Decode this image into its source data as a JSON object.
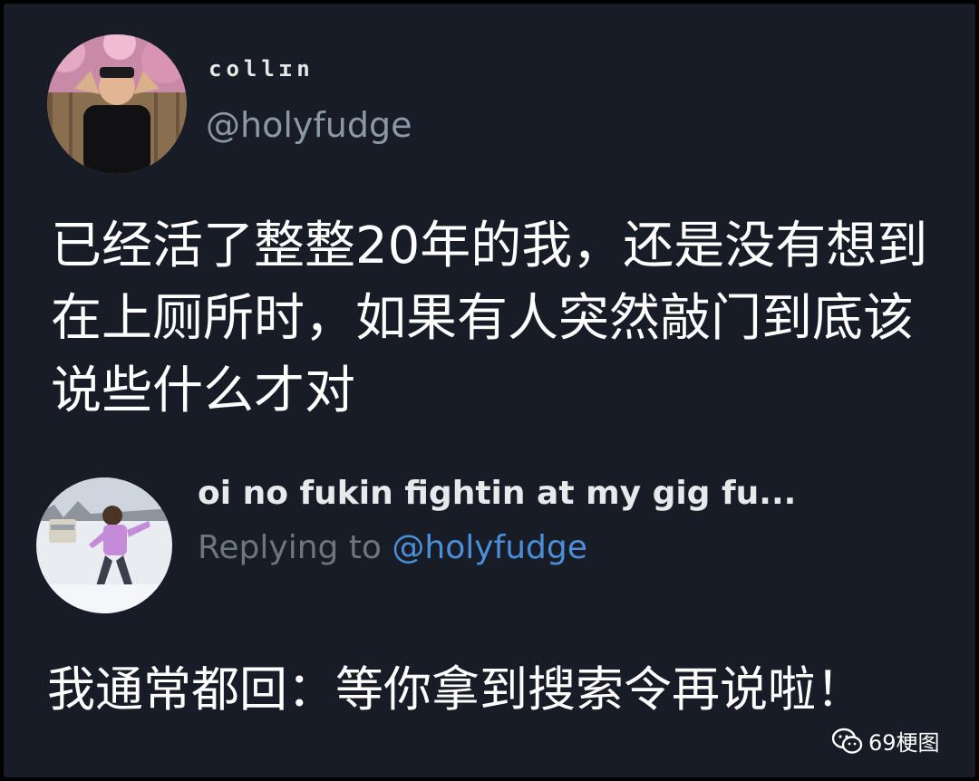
{
  "author": {
    "display_name": "collɪn",
    "handle": "@holyfudge"
  },
  "tweet": {
    "text": "已经活了整整20年的我，还是没有想到在上厕所时，如果有人突然敲门到底该说些什么才对"
  },
  "reply": {
    "author_name": "oi no fukin fightin at my gig fu...",
    "replying_prefix": "Replying to ",
    "replying_handle": "@holyfudge",
    "text": "我通常都回：等你拿到搜索令再说啦！"
  },
  "watermark": {
    "label": "69梗图",
    "icon": "wechat-icon"
  },
  "colors": {
    "background": "#181c26",
    "border": "#000000",
    "text_primary": "#ffffff",
    "text_secondary": "#8b98a5",
    "mention": "#4a8fd8"
  }
}
